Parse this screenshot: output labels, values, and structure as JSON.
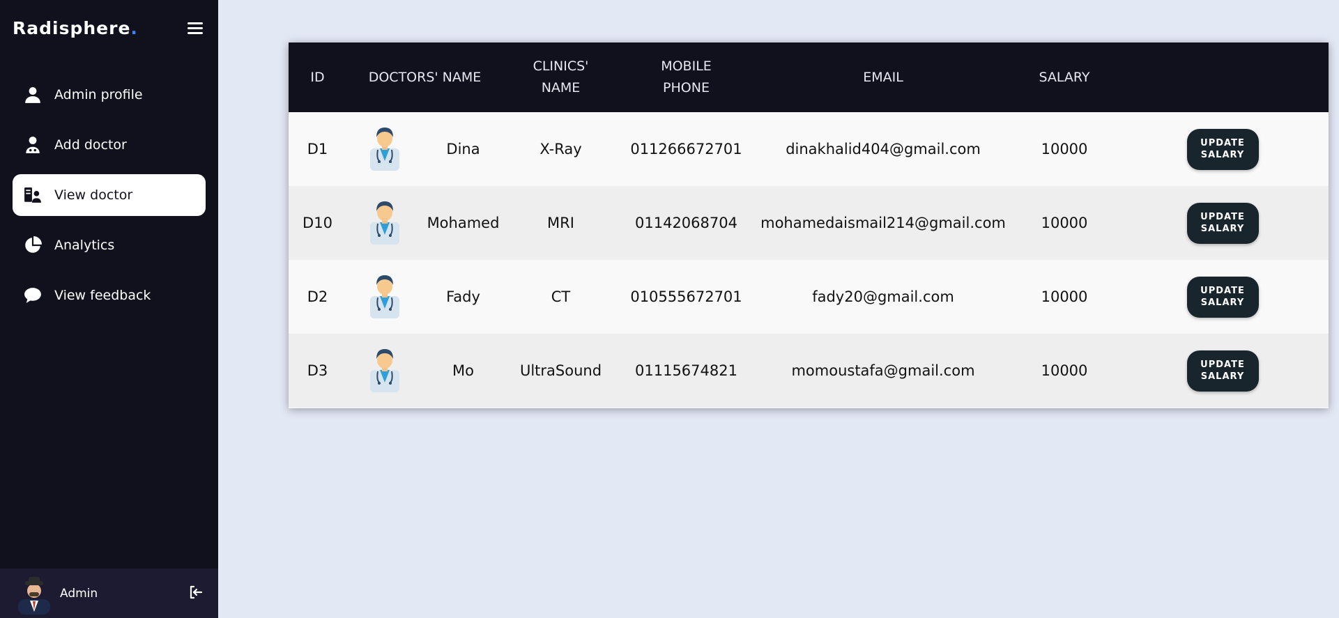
{
  "brand": {
    "name": "Radisphere",
    "dot": "."
  },
  "sidebar": {
    "items": [
      {
        "label": "Admin profile",
        "icon": "user-icon"
      },
      {
        "label": "Add doctor",
        "icon": "doctor-add-icon"
      },
      {
        "label": "View doctor",
        "icon": "doctor-list-icon",
        "active": true
      },
      {
        "label": "Analytics",
        "icon": "pie-chart-icon"
      },
      {
        "label": "View feedback",
        "icon": "chat-bubble-icon"
      }
    ],
    "profile": {
      "name": "Admin",
      "avatar": "admin-avatar",
      "logout_icon": "logout-icon"
    }
  },
  "table": {
    "headers": {
      "id": "ID",
      "doctor_name": "DOCTORS' NAME",
      "clinic_name": "CLINICS' NAME",
      "mobile_phone": "MOBILE PHONE",
      "email": "EMAIL",
      "salary": "SALARY"
    },
    "rows": [
      {
        "id": "D1",
        "name": "Dina",
        "clinic": "X-Ray",
        "phone": "011266672701",
        "email": "dinakhalid404@gmail.com",
        "salary": "10000",
        "button": "UPDATE SALARY"
      },
      {
        "id": "D10",
        "name": "Mohamed",
        "clinic": "MRI",
        "phone": "01142068704",
        "email": "mohamedaismail214@gmail.com",
        "salary": "10000",
        "button": "UPDATE SALARY"
      },
      {
        "id": "D2",
        "name": "Fady",
        "clinic": "CT",
        "phone": "010555672701",
        "email": "fady20@gmail.com",
        "salary": "10000",
        "button": "UPDATE SALARY"
      },
      {
        "id": "D3",
        "name": "Mo",
        "clinic": "UltraSound",
        "phone": "01115674821",
        "email": "momoustafa@gmail.com",
        "salary": "10000",
        "button": "UPDATE SALARY"
      }
    ]
  },
  "colors": {
    "sidebar_bg": "#11101d",
    "page_bg": "#e3e8f5",
    "button_bg": "#18252c",
    "brand_dot": "#3b82f6"
  }
}
